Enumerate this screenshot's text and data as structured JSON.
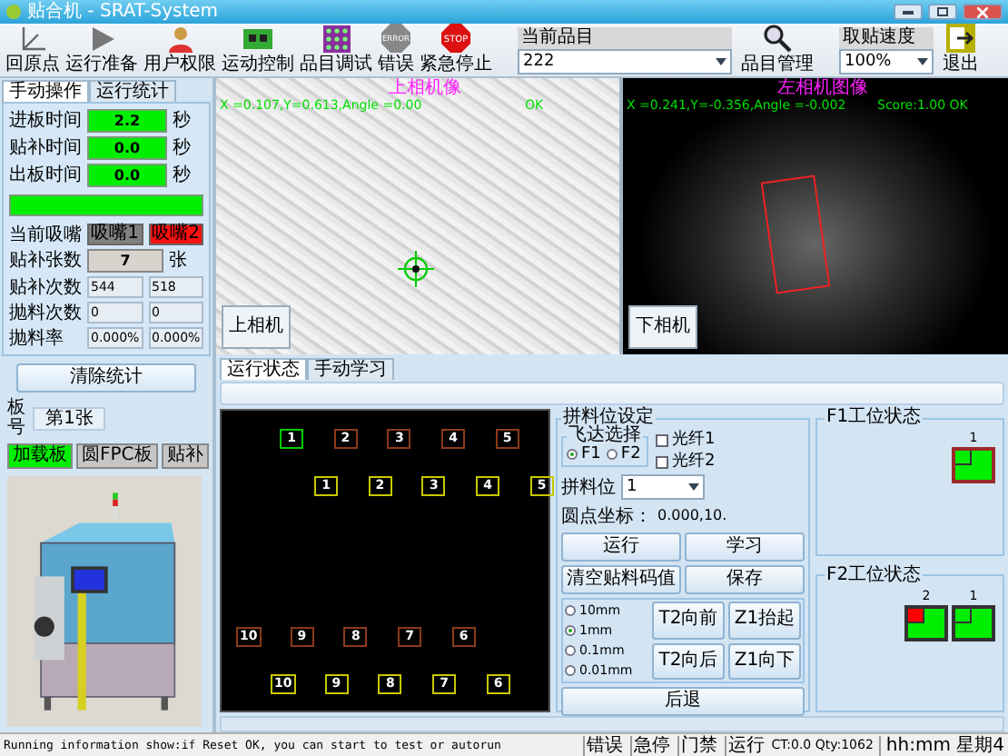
{
  "window": {
    "title": "贴合机 - SRAT-System"
  },
  "toolbar": [
    {
      "kind": "home",
      "label": "回原点"
    },
    {
      "kind": "run",
      "label": "运行准备"
    },
    {
      "kind": "user",
      "label": "用户权限"
    },
    {
      "kind": "motion",
      "label": "运动控制"
    },
    {
      "kind": "debug",
      "label": "品目调试"
    },
    {
      "kind": "error",
      "sign_text": "ERROR",
      "label": "错误"
    },
    {
      "kind": "stop",
      "sign_text": "STOP",
      "label": "紧急停止"
    },
    {
      "kind": "product",
      "label": "当前品目",
      "value": "222"
    },
    {
      "kind": "manage",
      "label": "品目管理"
    },
    {
      "kind": "speed",
      "label": "取贴速度",
      "value": "100%"
    },
    {
      "kind": "exit",
      "label": "退出"
    }
  ],
  "left_panel": {
    "tabs": [
      {
        "label": "手动操作",
        "selected": true
      },
      {
        "label": "运行统计",
        "selected": false
      }
    ],
    "timings": [
      {
        "label": "进板时间",
        "value": "2.2",
        "unit": "秒"
      },
      {
        "label": "贴补时间",
        "value": "0.0",
        "unit": "秒"
      },
      {
        "label": "出板时间",
        "value": "0.0",
        "unit": "秒"
      }
    ],
    "nozzle": {
      "label": "当前吸嘴",
      "options": [
        {
          "label": "吸嘴1",
          "selected": false
        },
        {
          "label": "吸嘴2",
          "selected": true
        }
      ]
    },
    "patch_count": {
      "label": "贴补张数",
      "value": "7",
      "unit": "张"
    },
    "stats": [
      {
        "label": "贴补次数",
        "values": [
          "544",
          "518"
        ]
      },
      {
        "label": "抛料次数",
        "values": [
          "0",
          "0"
        ]
      },
      {
        "label": "抛料率",
        "values": [
          "0.000%",
          "0.000%"
        ]
      }
    ],
    "clear_button": "清除统计",
    "board": {
      "label": "板号",
      "value": "第1张"
    },
    "board_types": [
      {
        "label": "加载板",
        "selected": true
      },
      {
        "label": "圆FPC板",
        "selected": false
      },
      {
        "label": "贴补",
        "selected": false
      }
    ]
  },
  "cameras": [
    {
      "kind": "top",
      "title": "上相机像",
      "readout": "X =0.107,Y=0.613,Angle =0.00",
      "result": "OK",
      "button": "上相机"
    },
    {
      "kind": "bottom",
      "title": "左相机图像",
      "readout": "X =0.241,Y=-0.356,Angle =-0.002",
      "result": "Score:1.00 OK",
      "button": "下相机"
    }
  ],
  "bottom_tabs": [
    {
      "label": "运行状态",
      "selected": true
    },
    {
      "label": "手动学习",
      "selected": false
    }
  ],
  "map": {
    "rows": [
      {
        "color": "#8b3a1a",
        "markers": [
          {
            "label": "1",
            "selected": true
          },
          {
            "label": "2",
            "selected": false
          },
          {
            "label": "3",
            "selected": false
          },
          {
            "label": "4",
            "selected": false
          },
          {
            "label": "5",
            "selected": false
          }
        ]
      },
      {
        "color": "#c8c800",
        "markers": [
          {
            "label": "1",
            "selected": false
          },
          {
            "label": "2",
            "selected": false
          },
          {
            "label": "3",
            "selected": false
          },
          {
            "label": "4",
            "selected": false
          },
          {
            "label": "5",
            "selected": false
          }
        ]
      },
      {
        "color": "#8b3a1a",
        "markers": [
          {
            "label": "10",
            "selected": false
          },
          {
            "label": "9",
            "selected": false
          },
          {
            "label": "8",
            "selected": false
          },
          {
            "label": "7",
            "selected": false
          },
          {
            "label": "6",
            "selected": false
          }
        ]
      },
      {
        "color": "#c8c800",
        "markers": [
          {
            "label": "10",
            "selected": false
          },
          {
            "label": "9",
            "selected": false
          },
          {
            "label": "8",
            "selected": false
          },
          {
            "label": "7",
            "selected": false
          },
          {
            "label": "6",
            "selected": false
          }
        ]
      }
    ]
  },
  "feeder_settings": {
    "title": "拼料位设定",
    "feeder_group": "飞达选择",
    "feeders": [
      {
        "label": "F1",
        "selected": true
      },
      {
        "label": "F2",
        "selected": false
      }
    ],
    "fibers": [
      {
        "label": "光纤1",
        "checked": false
      },
      {
        "label": "光纤2",
        "checked": false
      }
    ],
    "slot_label": "拼料位",
    "slot_value": "1",
    "origin_label": "圆点坐标：",
    "origin_value": "0.000,10.",
    "buttons": [
      "运行",
      "学习",
      "清空贴料码值",
      "保存"
    ],
    "steps": [
      {
        "label": "10mm",
        "selected": false
      },
      {
        "label": "1mm",
        "selected": true
      },
      {
        "label": "0.1mm",
        "selected": false
      },
      {
        "label": "0.01mm",
        "selected": false
      }
    ],
    "jog_buttons": [
      "T2向前",
      "Z1抬起",
      "T2向后",
      "Z1向下"
    ],
    "back_button": "后退"
  },
  "stations": [
    {
      "title": "F1工位状态",
      "slots": [
        {
          "label": "1",
          "color": "#00ee00",
          "selected": true
        }
      ]
    },
    {
      "title": "F2工位状态",
      "slots": [
        {
          "label": "2",
          "color": "#ff0000",
          "selected": false
        },
        {
          "label": "1",
          "color": "#00ee00",
          "selected": false
        }
      ]
    }
  ],
  "status_bar": {
    "message": "Running information show:if Reset OK, you can start to test or autorun",
    "indicators": [
      "错误",
      "急停",
      "门禁",
      "运行"
    ],
    "counter": "CT:0.0 Qty:1062",
    "clock": "hh:mm 星期4"
  }
}
